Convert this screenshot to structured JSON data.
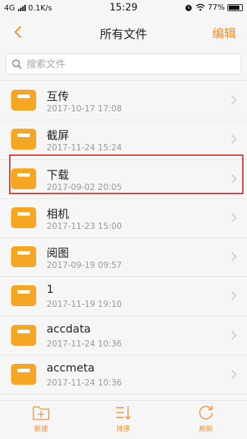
{
  "status_bar": {
    "network": "4G",
    "speed": "0.1K/s",
    "time": "15:29",
    "battery": "77%"
  },
  "nav": {
    "title": "所有文件",
    "edit_label": "编辑",
    "back_icon": "chevron-left-icon"
  },
  "search": {
    "placeholder": "搜索文件",
    "icon": "search-icon"
  },
  "files": [
    {
      "name": "互传",
      "date": "2017-10-17 17:08"
    },
    {
      "name": "截屏",
      "date": "2017-11-24 15:24"
    },
    {
      "name": "下载",
      "date": "2017-09-02 20:05"
    },
    {
      "name": "相机",
      "date": "2017-11-23 15:00"
    },
    {
      "name": "阅图",
      "date": "2017-09-19 09:57"
    },
    {
      "name": "1",
      "date": "2017-11-19 19:10"
    },
    {
      "name": "accdata",
      "date": "2017-11-24 10:36"
    },
    {
      "name": "accmeta",
      "date": "2017-11-24 10:36"
    }
  ],
  "toolbar": {
    "new_label": "新建",
    "sort_label": "排序",
    "refresh_label": "刷新"
  },
  "colors": {
    "accent": "#f08c2a",
    "folder": "#f5a623",
    "highlight": "#e03a3a"
  }
}
